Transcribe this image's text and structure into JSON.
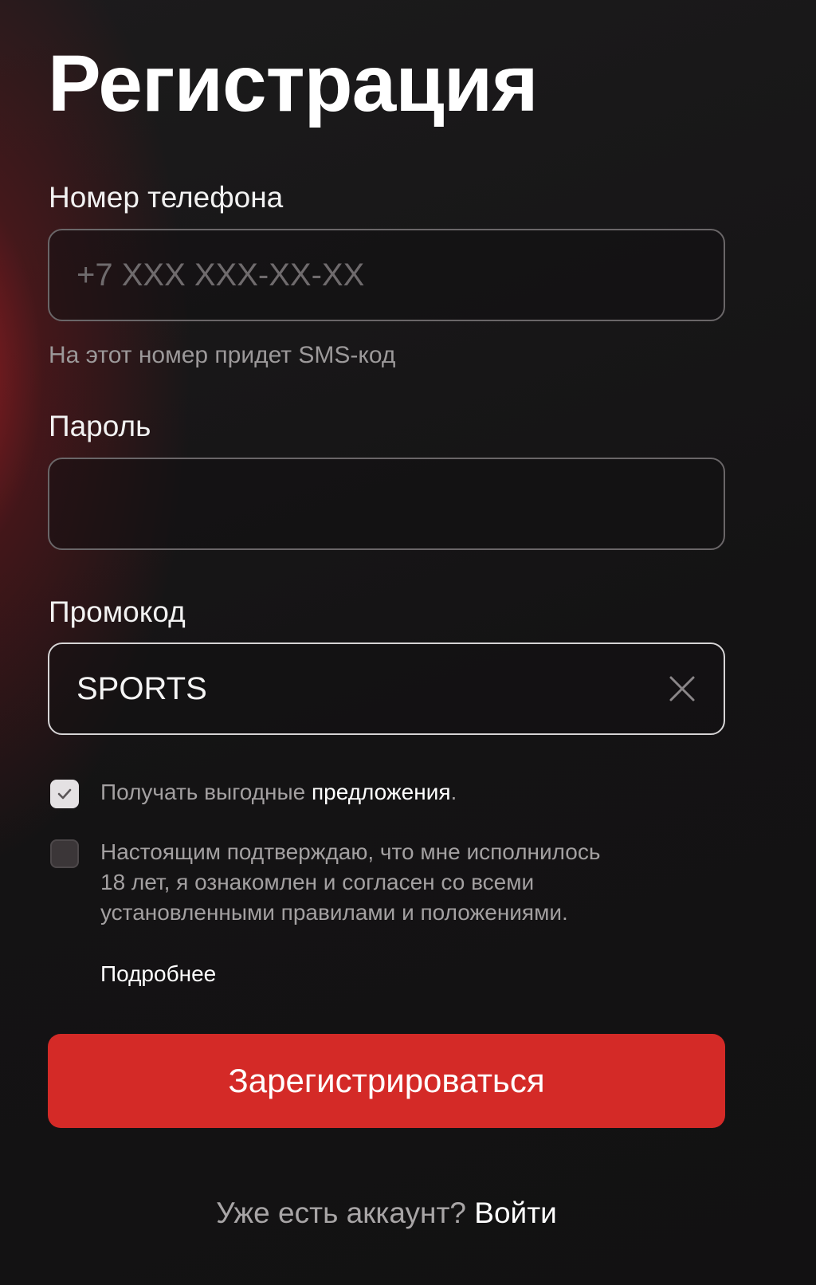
{
  "title": "Регистрация",
  "phone": {
    "label": "Номер телефона",
    "placeholder": "+7 XXX XXX-XX-XX",
    "value": "",
    "hint": "На этот номер придет SMS-код"
  },
  "password": {
    "label": "Пароль",
    "value": ""
  },
  "promo": {
    "label": "Промокод",
    "value": "SPORTS",
    "clear_icon": "close-icon"
  },
  "offers_checkbox": {
    "checked": true,
    "text_prefix": "Получать выгодные ",
    "text_link": "предложения",
    "text_suffix": "."
  },
  "age_checkbox": {
    "checked": false,
    "lines": [
      "Настоящим подтверждаю, что мне исполнилось",
      "18 лет, я ознакомлен и согласен со всеми",
      "установленными правилами и положениями."
    ],
    "more_link": "Подробнее"
  },
  "submit_label": "Зарегистрироваться",
  "footer": {
    "question": "Уже есть аккаунт?",
    "login_label": "Войти"
  },
  "colors": {
    "background": "#141314",
    "accent": "#d42a27",
    "glow": "#aa1e24"
  }
}
